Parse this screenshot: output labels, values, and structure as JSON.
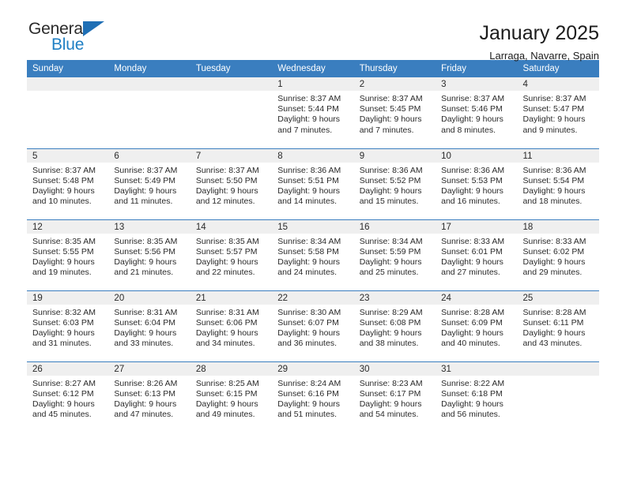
{
  "brand": {
    "name_top": "General",
    "name_bottom": "Blue",
    "accent_color": "#1f7fc4",
    "triangle_color": "#1f6fb5"
  },
  "header": {
    "title": "January 2025",
    "subtitle": "Larraga, Navarre, Spain"
  },
  "theme": {
    "header_row_bg": "#3a7ebf",
    "daynum_bg": "#efefef",
    "text": "#2a2a2a"
  },
  "weekdays": [
    "Sunday",
    "Monday",
    "Tuesday",
    "Wednesday",
    "Thursday",
    "Friday",
    "Saturday"
  ],
  "labels": {
    "sunrise": "Sunrise:",
    "sunset": "Sunset:",
    "daylight": "Daylight:"
  },
  "weeks": [
    [
      {
        "day": "",
        "empty": true
      },
      {
        "day": "",
        "empty": true
      },
      {
        "day": "",
        "empty": true
      },
      {
        "day": "1",
        "sunrise": "Sunrise: 8:37 AM",
        "sunset": "Sunset: 5:44 PM",
        "daylight": "Daylight: 9 hours and 7 minutes."
      },
      {
        "day": "2",
        "sunrise": "Sunrise: 8:37 AM",
        "sunset": "Sunset: 5:45 PM",
        "daylight": "Daylight: 9 hours and 7 minutes."
      },
      {
        "day": "3",
        "sunrise": "Sunrise: 8:37 AM",
        "sunset": "Sunset: 5:46 PM",
        "daylight": "Daylight: 9 hours and 8 minutes."
      },
      {
        "day": "4",
        "sunrise": "Sunrise: 8:37 AM",
        "sunset": "Sunset: 5:47 PM",
        "daylight": "Daylight: 9 hours and 9 minutes."
      }
    ],
    [
      {
        "day": "5",
        "sunrise": "Sunrise: 8:37 AM",
        "sunset": "Sunset: 5:48 PM",
        "daylight": "Daylight: 9 hours and 10 minutes."
      },
      {
        "day": "6",
        "sunrise": "Sunrise: 8:37 AM",
        "sunset": "Sunset: 5:49 PM",
        "daylight": "Daylight: 9 hours and 11 minutes."
      },
      {
        "day": "7",
        "sunrise": "Sunrise: 8:37 AM",
        "sunset": "Sunset: 5:50 PM",
        "daylight": "Daylight: 9 hours and 12 minutes."
      },
      {
        "day": "8",
        "sunrise": "Sunrise: 8:36 AM",
        "sunset": "Sunset: 5:51 PM",
        "daylight": "Daylight: 9 hours and 14 minutes."
      },
      {
        "day": "9",
        "sunrise": "Sunrise: 8:36 AM",
        "sunset": "Sunset: 5:52 PM",
        "daylight": "Daylight: 9 hours and 15 minutes."
      },
      {
        "day": "10",
        "sunrise": "Sunrise: 8:36 AM",
        "sunset": "Sunset: 5:53 PM",
        "daylight": "Daylight: 9 hours and 16 minutes."
      },
      {
        "day": "11",
        "sunrise": "Sunrise: 8:36 AM",
        "sunset": "Sunset: 5:54 PM",
        "daylight": "Daylight: 9 hours and 18 minutes."
      }
    ],
    [
      {
        "day": "12",
        "sunrise": "Sunrise: 8:35 AM",
        "sunset": "Sunset: 5:55 PM",
        "daylight": "Daylight: 9 hours and 19 minutes."
      },
      {
        "day": "13",
        "sunrise": "Sunrise: 8:35 AM",
        "sunset": "Sunset: 5:56 PM",
        "daylight": "Daylight: 9 hours and 21 minutes."
      },
      {
        "day": "14",
        "sunrise": "Sunrise: 8:35 AM",
        "sunset": "Sunset: 5:57 PM",
        "daylight": "Daylight: 9 hours and 22 minutes."
      },
      {
        "day": "15",
        "sunrise": "Sunrise: 8:34 AM",
        "sunset": "Sunset: 5:58 PM",
        "daylight": "Daylight: 9 hours and 24 minutes."
      },
      {
        "day": "16",
        "sunrise": "Sunrise: 8:34 AM",
        "sunset": "Sunset: 5:59 PM",
        "daylight": "Daylight: 9 hours and 25 minutes."
      },
      {
        "day": "17",
        "sunrise": "Sunrise: 8:33 AM",
        "sunset": "Sunset: 6:01 PM",
        "daylight": "Daylight: 9 hours and 27 minutes."
      },
      {
        "day": "18",
        "sunrise": "Sunrise: 8:33 AM",
        "sunset": "Sunset: 6:02 PM",
        "daylight": "Daylight: 9 hours and 29 minutes."
      }
    ],
    [
      {
        "day": "19",
        "sunrise": "Sunrise: 8:32 AM",
        "sunset": "Sunset: 6:03 PM",
        "daylight": "Daylight: 9 hours and 31 minutes."
      },
      {
        "day": "20",
        "sunrise": "Sunrise: 8:31 AM",
        "sunset": "Sunset: 6:04 PM",
        "daylight": "Daylight: 9 hours and 33 minutes."
      },
      {
        "day": "21",
        "sunrise": "Sunrise: 8:31 AM",
        "sunset": "Sunset: 6:06 PM",
        "daylight": "Daylight: 9 hours and 34 minutes."
      },
      {
        "day": "22",
        "sunrise": "Sunrise: 8:30 AM",
        "sunset": "Sunset: 6:07 PM",
        "daylight": "Daylight: 9 hours and 36 minutes."
      },
      {
        "day": "23",
        "sunrise": "Sunrise: 8:29 AM",
        "sunset": "Sunset: 6:08 PM",
        "daylight": "Daylight: 9 hours and 38 minutes."
      },
      {
        "day": "24",
        "sunrise": "Sunrise: 8:28 AM",
        "sunset": "Sunset: 6:09 PM",
        "daylight": "Daylight: 9 hours and 40 minutes."
      },
      {
        "day": "25",
        "sunrise": "Sunrise: 8:28 AM",
        "sunset": "Sunset: 6:11 PM",
        "daylight": "Daylight: 9 hours and 43 minutes."
      }
    ],
    [
      {
        "day": "26",
        "sunrise": "Sunrise: 8:27 AM",
        "sunset": "Sunset: 6:12 PM",
        "daylight": "Daylight: 9 hours and 45 minutes."
      },
      {
        "day": "27",
        "sunrise": "Sunrise: 8:26 AM",
        "sunset": "Sunset: 6:13 PM",
        "daylight": "Daylight: 9 hours and 47 minutes."
      },
      {
        "day": "28",
        "sunrise": "Sunrise: 8:25 AM",
        "sunset": "Sunset: 6:15 PM",
        "daylight": "Daylight: 9 hours and 49 minutes."
      },
      {
        "day": "29",
        "sunrise": "Sunrise: 8:24 AM",
        "sunset": "Sunset: 6:16 PM",
        "daylight": "Daylight: 9 hours and 51 minutes."
      },
      {
        "day": "30",
        "sunrise": "Sunrise: 8:23 AM",
        "sunset": "Sunset: 6:17 PM",
        "daylight": "Daylight: 9 hours and 54 minutes."
      },
      {
        "day": "31",
        "sunrise": "Sunrise: 8:22 AM",
        "sunset": "Sunset: 6:18 PM",
        "daylight": "Daylight: 9 hours and 56 minutes."
      },
      {
        "day": "",
        "empty": true
      }
    ]
  ]
}
